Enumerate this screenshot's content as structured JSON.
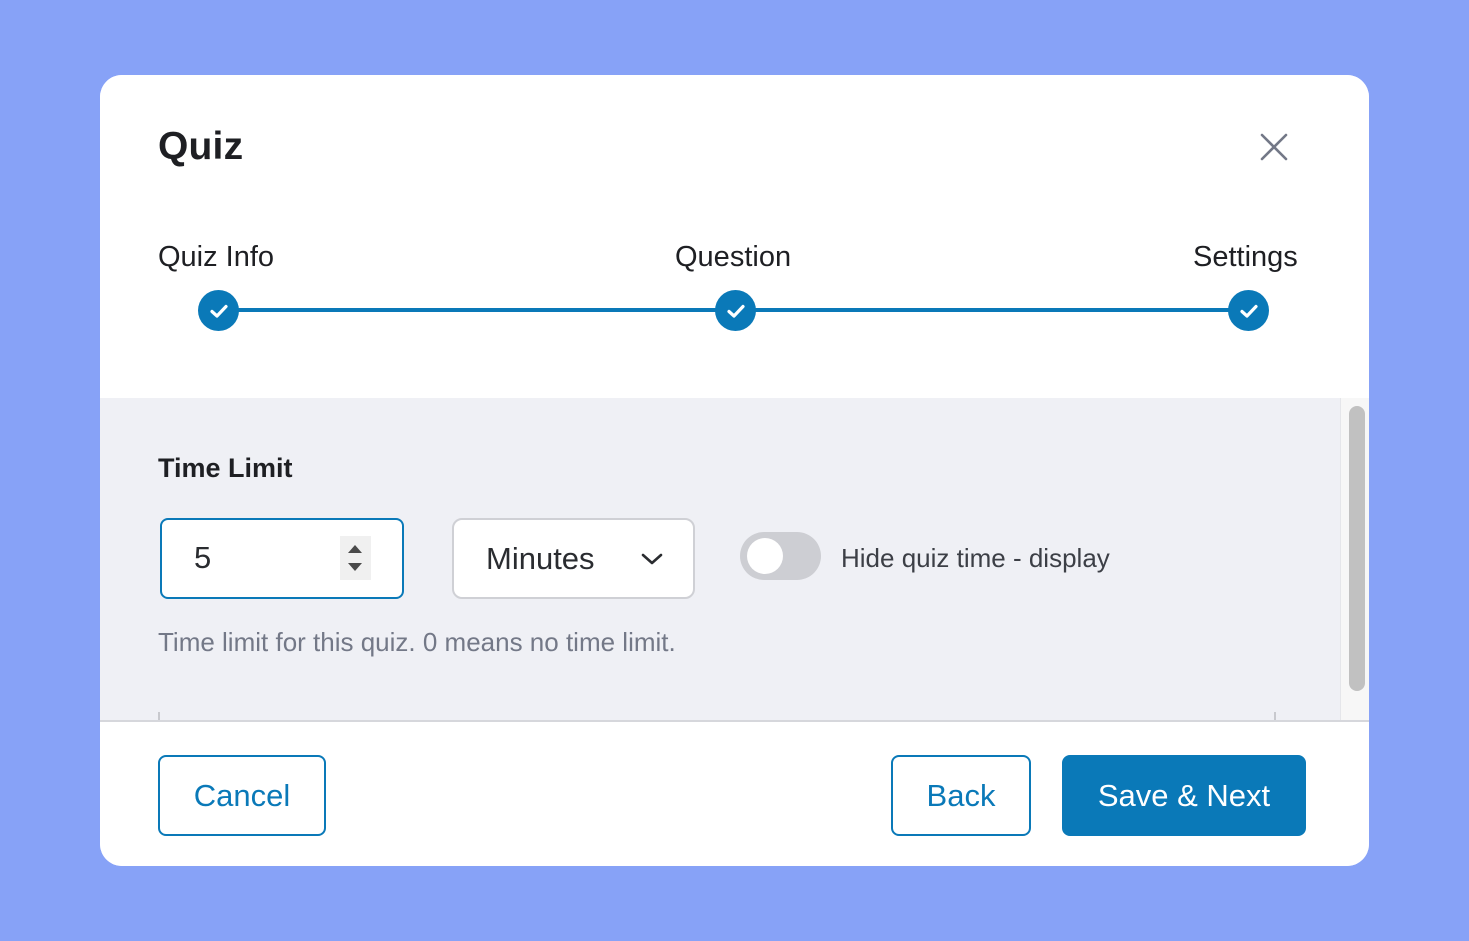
{
  "modal": {
    "title": "Quiz",
    "close_icon": "close-icon"
  },
  "stepper": {
    "accent_color": "#0a79b8",
    "steps": [
      {
        "label": "Quiz Info",
        "status": "complete",
        "icon": "check-icon"
      },
      {
        "label": "Question",
        "status": "complete",
        "icon": "check-icon"
      },
      {
        "label": "Settings",
        "status": "complete",
        "icon": "check-icon"
      }
    ]
  },
  "time_limit": {
    "section_title": "Time Limit",
    "value": "5",
    "unit_selected": "Minutes",
    "hide_time_toggle": {
      "label": "Hide quiz time - display",
      "checked": false
    },
    "help_text": "Time limit for this quiz. 0 means no time limit."
  },
  "footer": {
    "cancel_label": "Cancel",
    "back_label": "Back",
    "save_next_label": "Save & Next"
  }
}
